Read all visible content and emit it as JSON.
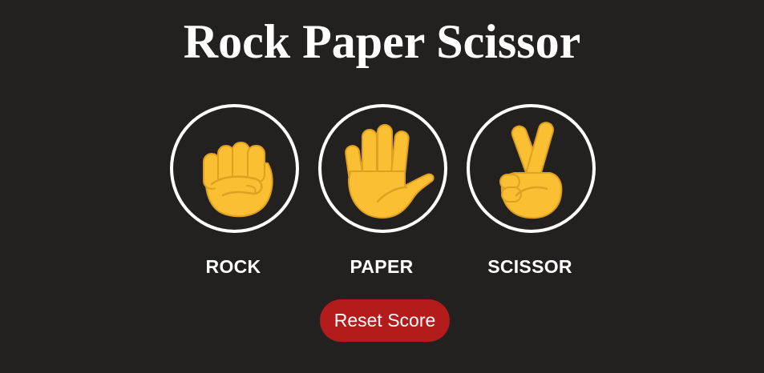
{
  "title": "Rock Paper Scissor",
  "choices": [
    {
      "id": "rock",
      "label": "ROCK",
      "icon": "fist-icon"
    },
    {
      "id": "paper",
      "label": "PAPER",
      "icon": "raised-hand-icon"
    },
    {
      "id": "scissor",
      "label": "SCISSOR",
      "icon": "victory-hand-icon"
    }
  ],
  "reset_label": "Reset Score",
  "colors": {
    "background": "#232020",
    "ring": "#ffffff",
    "hand": "#FBBF33",
    "hand_shade": "#E0A020",
    "reset": "#B41C1C",
    "text": "#FFFFFF"
  }
}
